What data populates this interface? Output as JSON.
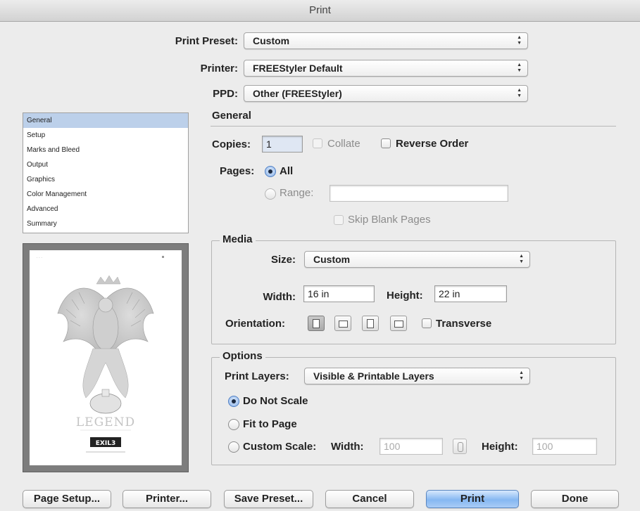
{
  "window": {
    "title": "Print"
  },
  "preset": {
    "label": "Print Preset:",
    "value": "Custom"
  },
  "printer": {
    "label": "Printer:",
    "value": "FREEStyler Default"
  },
  "ppd": {
    "label": "PPD:",
    "value": "Other (FREEStyler)"
  },
  "sidebar": {
    "items": [
      {
        "label": "General",
        "selected": true
      },
      {
        "label": "Setup"
      },
      {
        "label": "Marks and Bleed"
      },
      {
        "label": "Output"
      },
      {
        "label": "Graphics"
      },
      {
        "label": "Color Management"
      },
      {
        "label": "Advanced"
      },
      {
        "label": "Summary"
      }
    ]
  },
  "general": {
    "heading": "General",
    "copies_label": "Copies:",
    "copies_value": "1",
    "collate_label": "Collate",
    "reverse_label": "Reverse Order",
    "pages_label": "Pages:",
    "all_label": "All",
    "range_label": "Range:",
    "range_value": "",
    "skip_blank_label": "Skip Blank Pages"
  },
  "media": {
    "title": "Media",
    "size_label": "Size:",
    "size_value": "Custom",
    "width_label": "Width:",
    "width_value": "16 in",
    "height_label": "Height:",
    "height_value": "22 in",
    "orientation_label": "Orientation:",
    "transverse_label": "Transverse"
  },
  "options": {
    "title": "Options",
    "print_layers_label": "Print Layers:",
    "print_layers_value": "Visible & Printable Layers",
    "do_not_scale_label": "Do Not Scale",
    "fit_to_page_label": "Fit to Page",
    "custom_scale_label": "Custom Scale:",
    "scale_width_label": "Width:",
    "scale_width_value": "100",
    "scale_height_label": "Height:",
    "scale_height_value": "100"
  },
  "buttons": {
    "page_setup": "Page Setup...",
    "printer": "Printer...",
    "save_preset": "Save Preset...",
    "cancel": "Cancel",
    "print": "Print",
    "done": "Done"
  },
  "colors": {
    "accent": "#86b7f2",
    "selection": "#bcd0ea"
  },
  "preview": {
    "poster_title": "LEGEND",
    "poster_logo": "EXIL3"
  }
}
